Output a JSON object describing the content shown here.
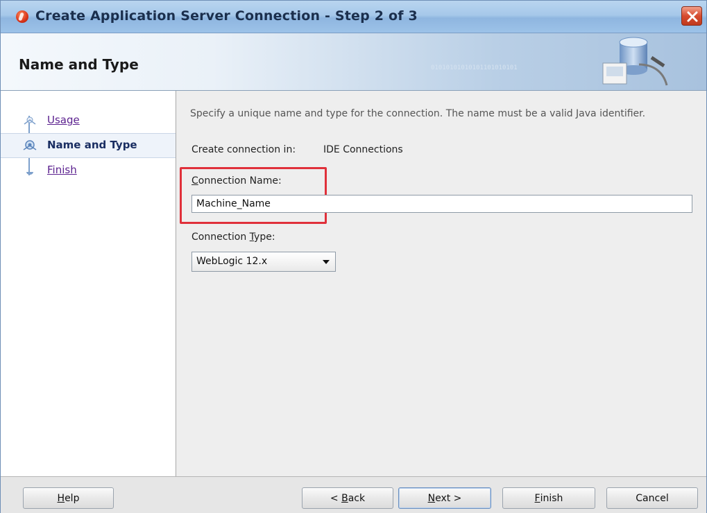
{
  "window": {
    "title": "Create Application Server Connection - Step 2 of 3"
  },
  "header": {
    "title": "Name and Type",
    "decoration_bits": "01010101010101101010101"
  },
  "nav": {
    "items": [
      {
        "label": "Usage",
        "state": "link"
      },
      {
        "label": "Name and Type",
        "state": "current"
      },
      {
        "label": "Finish",
        "state": "link"
      }
    ]
  },
  "main": {
    "instructions": "Specify a unique name and type for the connection. The name must be a valid Java identifier.",
    "create_in_label": "Create connection in:",
    "create_in_value": "IDE Connections",
    "connection_name_label": {
      "mnemonic": "C",
      "rest": "onnection Name:"
    },
    "connection_name_value": "Machine_Name",
    "connection_type_label": {
      "before": "Connection ",
      "mnemonic": "T",
      "after": "ype:"
    },
    "connection_type_value": "WebLogic 12.x"
  },
  "footer": {
    "help": {
      "mnemonic": "H",
      "rest": "elp"
    },
    "back": {
      "prefix": "< ",
      "mnemonic": "B",
      "rest": "ack"
    },
    "next": {
      "mnemonic": "N",
      "rest": "ext >"
    },
    "finish": {
      "mnemonic": "F",
      "rest": "inish"
    },
    "cancel": "Cancel"
  },
  "colors": {
    "highlight": "#e0303a",
    "link": "#5a1f8e",
    "current_step": "#1a2e62"
  }
}
